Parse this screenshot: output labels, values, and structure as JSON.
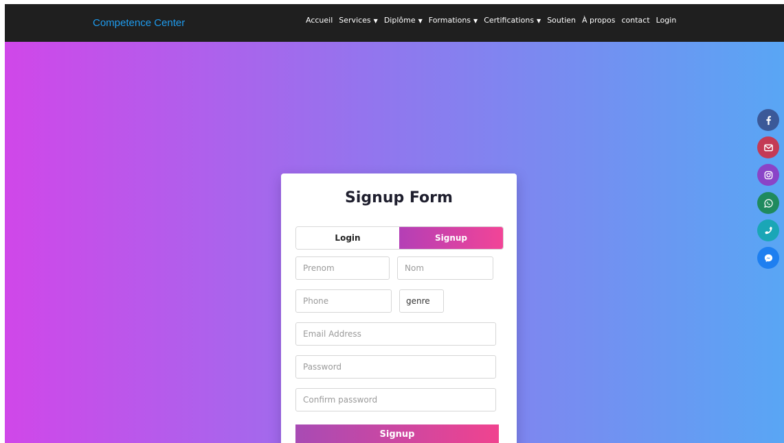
{
  "brand": "Competence Center",
  "nav": [
    {
      "label": "Accueil",
      "dropdown": false
    },
    {
      "label": "Services",
      "dropdown": true
    },
    {
      "label": "Diplôme",
      "dropdown": true
    },
    {
      "label": "Formations",
      "dropdown": true
    },
    {
      "label": "Certifications",
      "dropdown": true
    },
    {
      "label": "Soutien",
      "dropdown": false
    },
    {
      "label": "À propos",
      "dropdown": false
    },
    {
      "label": "contact",
      "dropdown": false
    },
    {
      "label": "Login",
      "dropdown": false
    }
  ],
  "form": {
    "title": "Signup Form",
    "tabs": {
      "login": "Login",
      "signup": "Signup",
      "active": "signup"
    },
    "fields": {
      "prenom": "Prenom",
      "nom": "Nom",
      "phone": "Phone",
      "genre": "genre",
      "email": "Email Address",
      "password": "Password",
      "confirm": "Confirm password"
    },
    "submit": "Signup"
  },
  "social": [
    {
      "name": "facebook-icon",
      "color": "#3b5998"
    },
    {
      "name": "email-icon",
      "color": "#c43a55"
    },
    {
      "name": "instagram-icon",
      "color": "#8a44c7"
    },
    {
      "name": "whatsapp-icon",
      "color": "#1f8a5e"
    },
    {
      "name": "phone-icon",
      "color": "#1aa6b6"
    },
    {
      "name": "messenger-icon",
      "color": "#1e7ff0"
    }
  ],
  "colors": {
    "navbar": "#1f1f1f",
    "brand": "#1e9cef",
    "gradient_start": "#d047e9",
    "gradient_end": "#59a6f4",
    "accent_start": "#b43fb6",
    "accent_end": "#f24497"
  }
}
